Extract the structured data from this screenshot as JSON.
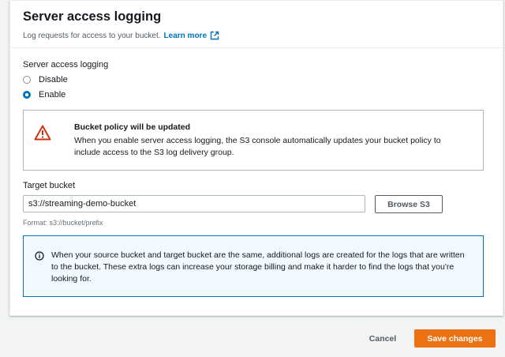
{
  "header": {
    "title": "Server access logging",
    "description": "Log requests for access to your bucket.",
    "learn_more": "Learn more"
  },
  "logging": {
    "label": "Server access logging",
    "options": [
      {
        "label": "Disable",
        "checked": false
      },
      {
        "label": "Enable",
        "checked": true
      }
    ]
  },
  "warning": {
    "title": "Bucket policy will be updated",
    "text": "When you enable server access logging, the S3 console automatically updates your bucket policy to include access to the S3 log delivery group."
  },
  "target": {
    "label": "Target bucket",
    "value": "s3://streaming-demo-bucket",
    "browse_label": "Browse S3",
    "format_hint": "Format: s3://bucket/prefix"
  },
  "info": {
    "text": "When your source bucket and target bucket are the same, additional logs are created for the logs that are written to the bucket. These extra logs can increase your storage billing and make it harder to find the logs that you're looking for."
  },
  "footer": {
    "cancel_label": "Cancel",
    "save_label": "Save changes"
  },
  "colors": {
    "primary": "#ec7211",
    "link": "#0073bb",
    "warning": "#d13212",
    "info_border": "#0073bb"
  }
}
